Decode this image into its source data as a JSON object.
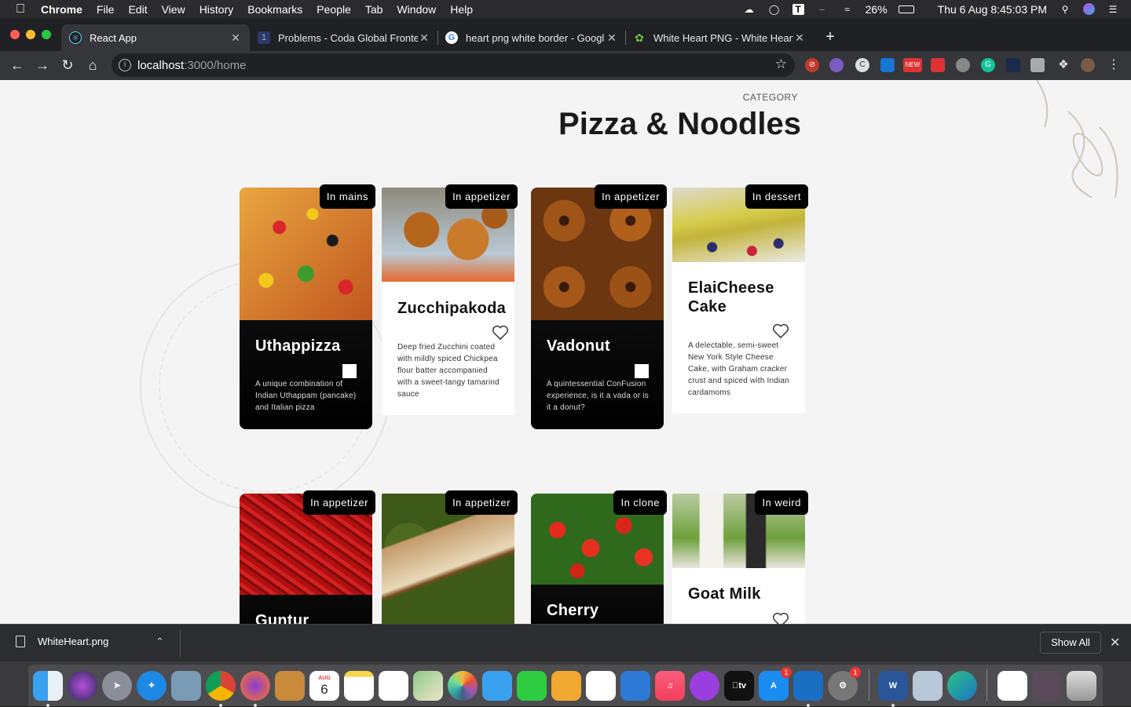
{
  "menubar": {
    "app": "Chrome",
    "items": [
      "File",
      "Edit",
      "View",
      "History",
      "Bookmarks",
      "People",
      "Tab",
      "Window",
      "Help"
    ],
    "battery": "26%",
    "datetime": "Thu 6 Aug  8:45:03 PM"
  },
  "tabs": [
    {
      "title": "React App",
      "favicon": "react-icon",
      "active": true
    },
    {
      "title": "Problems - Coda Global Fronte",
      "favicon": "coda-icon",
      "active": false
    },
    {
      "title": "heart png white border - Googl",
      "favicon": "google-icon",
      "active": false
    },
    {
      "title": "White Heart PNG - White Heart",
      "favicon": "leaf-icon",
      "active": false
    }
  ],
  "address": {
    "host": "localhost",
    "path": ":3000/home"
  },
  "page": {
    "category_label": "CATEGORY",
    "title": "Pizza & Noodles",
    "cards": [
      {
        "name": "Uthappizza",
        "badge": "In mains",
        "desc": "A unique combination of Indian Uthappam (pancake) and Italian pizza",
        "style": "dark"
      },
      {
        "name": "Zucchipakoda",
        "badge": "In appetizer",
        "desc": "Deep fried Zucchini coated with mildly spiced Chickpea flour batter accompanied with a sweet-tangy tamarind sauce",
        "style": "light"
      },
      {
        "name": "Vadonut",
        "badge": "In appetizer",
        "desc": "A quintessential ConFusion experience, is it a vada or is it a donut?",
        "style": "dark"
      },
      {
        "name": "ElaiCheese Cake",
        "badge": "In dessert",
        "desc": "A delectable, semi-sweet New York Style Cheese Cake, with Graham cracker crust and spiced with Indian cardamoms",
        "style": "light"
      },
      {
        "name": "Guntur",
        "badge": "In appetizer",
        "style": "dark"
      },
      {
        "name": "",
        "badge": "In appetizer",
        "style": "light"
      },
      {
        "name": "Cherry",
        "badge": "In clone",
        "style": "dark"
      },
      {
        "name": "Goat Milk",
        "badge": "In weird",
        "style": "light"
      }
    ]
  },
  "download": {
    "filename": "WhiteHeart.png",
    "show_all": "Show All"
  },
  "dock": {
    "calendar_month": "AUG",
    "calendar_day": "6",
    "badge": "1",
    "tv_label": "tv",
    "word_label": "W"
  }
}
